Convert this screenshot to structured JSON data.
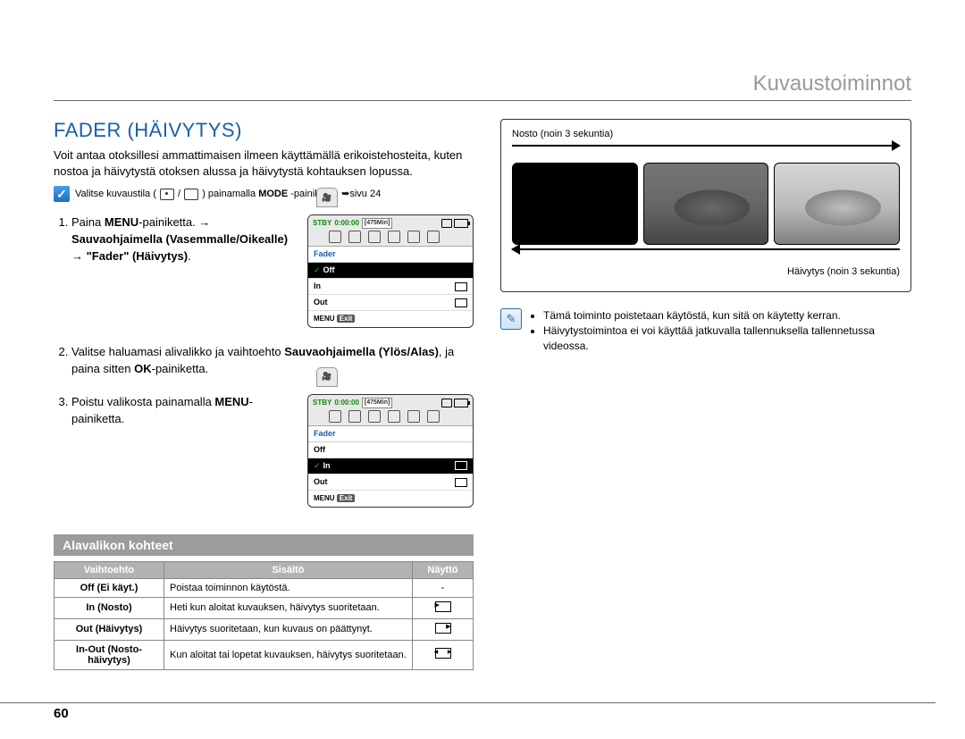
{
  "header": {
    "section": "Kuvaustoiminnot"
  },
  "title": "FADER (HÄIVYTYS)",
  "intro": "Voit antaa otoksillesi ammattimaisen ilmeen käyttämällä erikoistehosteita, kuten nostoa ja häivytystä otoksen alussa ja häivytystä kohtauksen lopussa.",
  "checkline": {
    "pre": "Valitse kuvaustila (",
    "mid": " / ",
    "post": ") painamalla ",
    "bold": "MODE",
    "suffix": "-painiketta. ➥sivu 24"
  },
  "steps": [
    {
      "pre": "Paina ",
      "b1": "MENU",
      "mid1": "-painiketta. → ",
      "b2": "Sauvaohjaimella (Vasemmalle/Oikealle)",
      "mid2": " → ",
      "b3": "\"Fader\" (Häivytys)",
      "end": "."
    },
    {
      "pre": "Valitse haluamasi alivalikko ja vaihtoehto ",
      "b1": "Sauvaohjaimella (Ylös/Alas)",
      "mid1": ", ja paina sitten ",
      "b2": "OK",
      "end": "-painiketta."
    },
    {
      "pre": "Poistu valikosta painamalla ",
      "b1": "MENU",
      "end": "-painiketta."
    }
  ],
  "screen": {
    "stby": "STBY",
    "time": "0:00:00",
    "remain": "[475Min]",
    "menu_title": "Fader",
    "items": {
      "off": "Off",
      "in": "In",
      "out": "Out"
    },
    "exit_menu": "MENU",
    "exit_label": "Exit"
  },
  "subheading": "Alavalikon kohteet",
  "table": {
    "headers": {
      "opt": "Vaihtoehto",
      "desc": "Sisältö",
      "disp": "Näyttö"
    },
    "rows": [
      {
        "opt": "Off (Ei käyt.)",
        "desc": "Poistaa toiminnon käytöstä.",
        "disp": "-"
      },
      {
        "opt": "In (Nosto)",
        "desc": "Heti kun aloitat kuvauksen, häivytys suoritetaan.",
        "disp": "in"
      },
      {
        "opt": "Out (Häivytys)",
        "desc": "Häivytys suoritetaan, kun kuvaus on päättynyt.",
        "disp": "out"
      },
      {
        "opt": "In-Out (Nosto-häivytys)",
        "desc": "Kun aloitat tai lopetat kuvauksen, häivytys suoritetaan.",
        "disp": "inout"
      }
    ]
  },
  "illustration": {
    "fadein_label": "Nosto (noin 3 sekuntia)",
    "fadeout_label": "Häivytys (noin 3 sekuntia)"
  },
  "notes": [
    "Tämä toiminto poistetaan käytöstä, kun sitä on käytetty kerran.",
    "Häivytystoimintoa ei voi käyttää jatkuvalla tallennuksella tallennetussa videossa."
  ],
  "page_number": "60"
}
